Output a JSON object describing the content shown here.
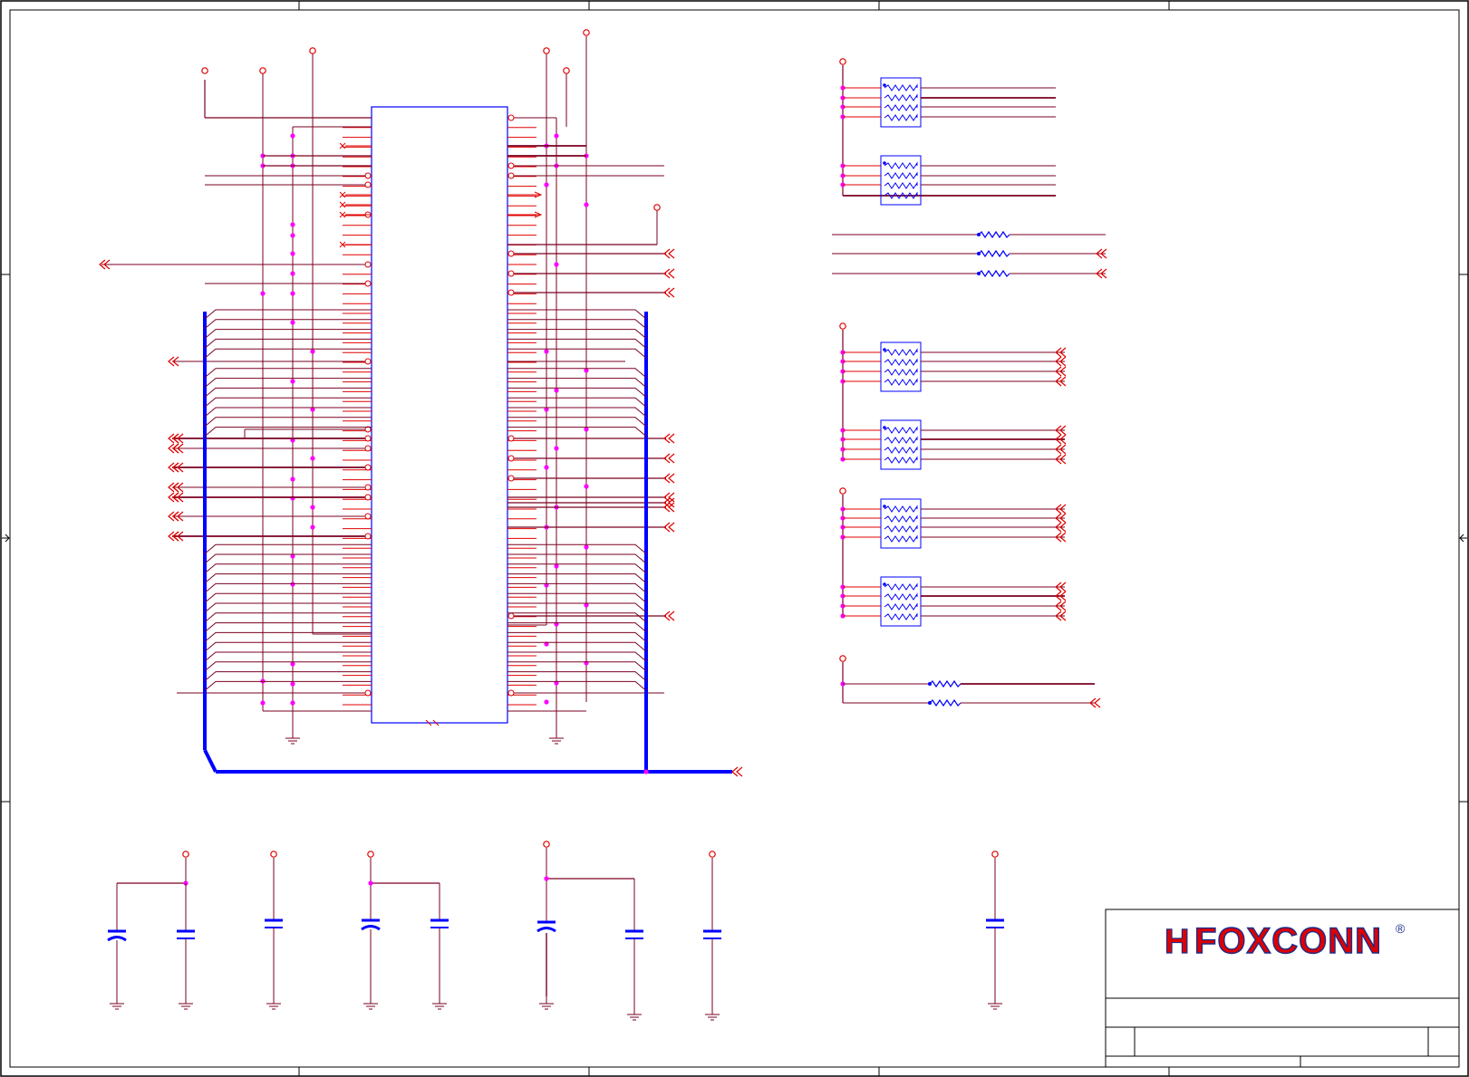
{
  "title_block": {
    "company_logo_text": "FOXCONN",
    "registered_mark": "®",
    "logo_mark": "H"
  },
  "colors": {
    "wire": "#e00000",
    "bus_wire": "#7a0020",
    "component": "#0000ff",
    "junction": "#ff00ff",
    "border": "#000000",
    "logo_red": "#e00000",
    "logo_blue": "#1a2e8a"
  },
  "icons": [
    "junction-dot",
    "power-port-circle",
    "ground-symbol",
    "offpage-connector-arrow",
    "resistor-network",
    "resistor",
    "capacitor",
    "polarized-capacitor"
  ]
}
